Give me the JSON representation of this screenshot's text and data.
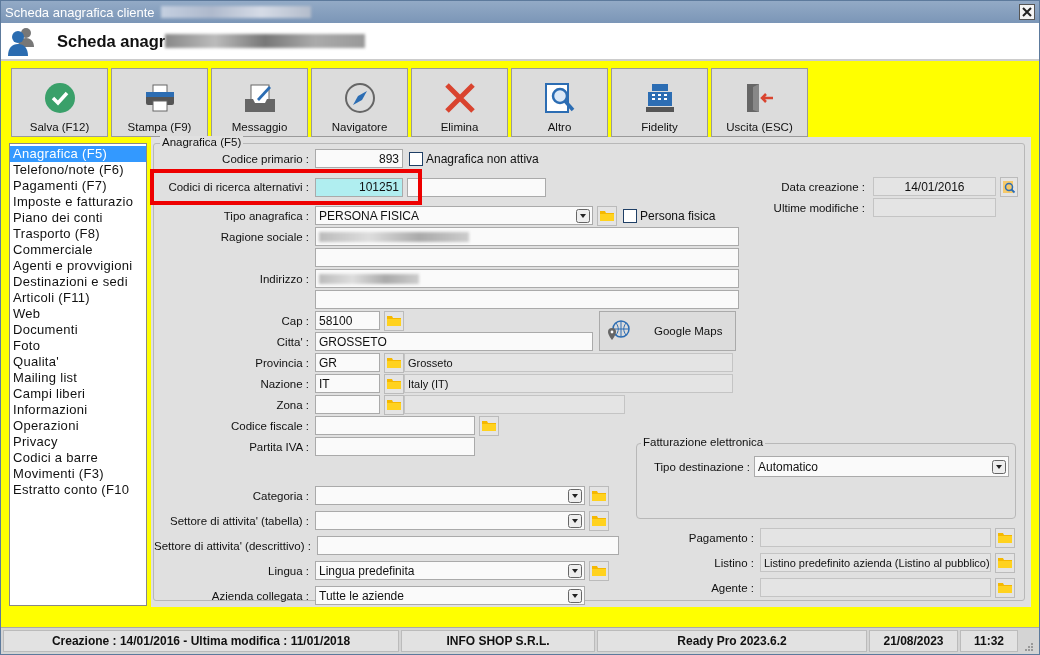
{
  "window": {
    "title": "Scheda anagrafica cliente",
    "heading": "Scheda anagr"
  },
  "toolbar": [
    {
      "label": "Salva (F12)",
      "kind": "save"
    },
    {
      "label": "Stampa (F9)",
      "kind": "print"
    },
    {
      "label": "Messaggio",
      "kind": "message"
    },
    {
      "label": "Navigatore",
      "kind": "navigator"
    },
    {
      "label": "Elimina",
      "kind": "delete"
    },
    {
      "label": "Altro",
      "kind": "other"
    },
    {
      "label": "Fidelity",
      "kind": "register"
    },
    {
      "label": "Uscita (ESC)",
      "kind": "exit"
    }
  ],
  "sidebar": {
    "items": [
      {
        "label": "Anagrafica (F5)",
        "selected": true
      },
      {
        "label": "Telefono/note (F6)",
        "selected": false
      },
      {
        "label": "Pagamenti (F7)",
        "selected": false
      },
      {
        "label": "Imposte e fatturazio",
        "selected": false
      },
      {
        "label": "Piano dei conti",
        "selected": false
      },
      {
        "label": "Trasporto (F8)",
        "selected": false
      },
      {
        "label": "Commerciale",
        "selected": false
      },
      {
        "label": "Agenti e provvigioni",
        "selected": false
      },
      {
        "label": "Destinazioni e sedi",
        "selected": false
      },
      {
        "label": "Articoli (F11)",
        "selected": false
      },
      {
        "label": "Web",
        "selected": false
      },
      {
        "label": "Documenti",
        "selected": false
      },
      {
        "label": "Foto",
        "selected": false
      },
      {
        "label": "Qualita'",
        "selected": false
      },
      {
        "label": "Mailing list",
        "selected": false
      },
      {
        "label": "Campi liberi",
        "selected": false
      },
      {
        "label": "Informazioni",
        "selected": false
      },
      {
        "label": "Operazioni",
        "selected": false
      },
      {
        "label": "Privacy",
        "selected": false
      },
      {
        "label": "Codici a barre",
        "selected": false
      },
      {
        "label": "Movimenti (F3)",
        "selected": false
      },
      {
        "label": "Estratto conto (F10",
        "selected": false
      }
    ]
  },
  "form": {
    "title": "Anagrafica (F5)",
    "codice_primario": {
      "label": "Codice primario :",
      "value": "893"
    },
    "non_attiva": {
      "label": "Anagrafica non attiva",
      "checked": false
    },
    "codici_ricerca": {
      "label": "Codici di ricerca alternativi :",
      "value": "101251"
    },
    "tipo_anagrafica": {
      "label": "Tipo anagrafica :",
      "value": "PERSONA FISICA"
    },
    "persona_fisica": {
      "label": "Persona fisica",
      "checked": false
    },
    "ragione_sociale": {
      "label": "Ragione sociale :"
    },
    "indirizzo": {
      "label": "Indirizzo :"
    },
    "cap": {
      "label": "Cap :",
      "value": "58100"
    },
    "citta": {
      "label": "Citta' :",
      "value": "GROSSETO"
    },
    "maps_button": "Google Maps",
    "provincia": {
      "label": "Provincia :",
      "value": "GR",
      "description": "Grosseto"
    },
    "nazione": {
      "label": "Nazione :",
      "value": "IT",
      "description": "Italy (IT)"
    },
    "zona": {
      "label": "Zona :"
    },
    "codice_fiscale": {
      "label": "Codice fiscale :"
    },
    "partita_iva": {
      "label": "Partita IVA :"
    },
    "categoria": {
      "label": "Categoria :"
    },
    "settore_tabella": {
      "label": "Settore di attivita' (tabella) :"
    },
    "settore_descrittivo": {
      "label": "Settore di attivita' (descrittivo) :"
    },
    "lingua": {
      "label": "Lingua :",
      "value": "Lingua predefinita"
    },
    "azienda": {
      "label": "Azienda collegata :",
      "value": "Tutte le aziende"
    },
    "data_creazione": {
      "label": "Data creazione :",
      "value": "14/01/2016"
    },
    "ultime_modifiche": {
      "label": "Ultime modifiche :"
    },
    "fatturazione": {
      "title": "Fatturazione elettronica",
      "tipo_destinazione": {
        "label": "Tipo destinazione :",
        "value": "Automatico"
      }
    },
    "pagamento": {
      "label": "Pagamento :"
    },
    "listino": {
      "label": "Listino :",
      "value": "Listino predefinito azienda (Listino al pubblico)"
    },
    "agente": {
      "label": "Agente :"
    }
  },
  "status_bar": [
    "Creazione : 14/01/2016 - Ultima modifica : 11/01/2018",
    "INFO SHOP S.R.L.",
    "Ready Pro 2023.6.2",
    "21/08/2023",
    "11:32"
  ]
}
